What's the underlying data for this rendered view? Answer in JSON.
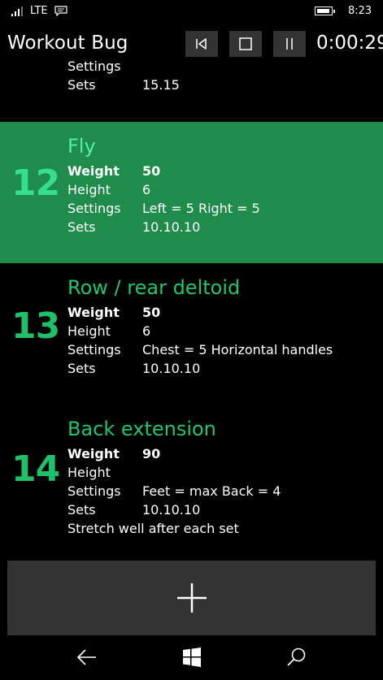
{
  "status": {
    "network": "LTE",
    "time": "8:23"
  },
  "header": {
    "title": "Workout Bug",
    "timer": "0:00:29"
  },
  "partial": {
    "rows": [
      {
        "label": "Settings",
        "value": ""
      },
      {
        "label": "Sets",
        "value": "15.15"
      }
    ]
  },
  "exercises": [
    {
      "number": "12",
      "name": "Fly",
      "weight_label": "Weight",
      "weight": "50",
      "height_label": "Height",
      "height": "6",
      "settings_label": "Settings",
      "settings": "Left = 5  Right = 5",
      "sets_label": "Sets",
      "sets": "10.10.10",
      "note": ""
    },
    {
      "number": "13",
      "name": "Row / rear deltoid",
      "weight_label": "Weight",
      "weight": "50",
      "height_label": "Height",
      "height": "6",
      "settings_label": "Settings",
      "settings": "Chest = 5  Horizontal handles",
      "sets_label": "Sets",
      "sets": "10.10.10",
      "note": ""
    },
    {
      "number": "14",
      "name": "Back extension",
      "weight_label": "Weight",
      "weight": "90",
      "height_label": "Height",
      "height": "",
      "settings_label": "Settings",
      "settings": "Feet = max  Back = 4",
      "sets_label": "Sets",
      "sets": "10.10.10",
      "note": "Stretch well after each set"
    }
  ],
  "colors": {
    "accent": "#1fc06a",
    "selected_bg": "#1f8c4c",
    "button_bg": "#333333"
  },
  "icons": [
    "signal-icon",
    "message-icon",
    "battery-icon",
    "previous-icon",
    "stop-icon",
    "pause-icon",
    "plus-icon",
    "back-icon",
    "windows-icon",
    "search-icon"
  ]
}
